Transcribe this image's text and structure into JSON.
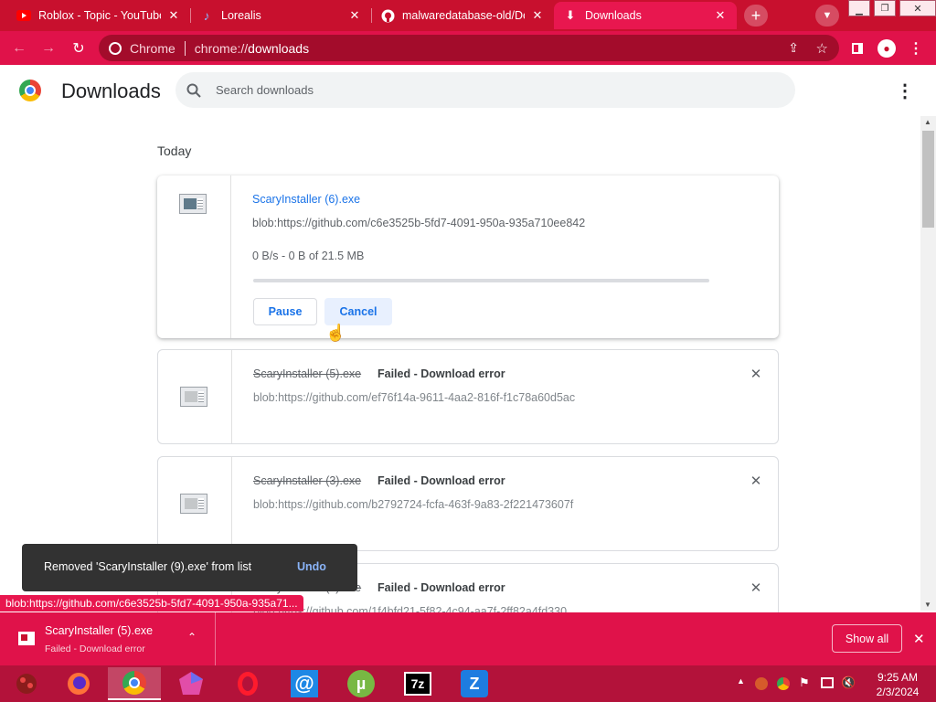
{
  "tabs": [
    {
      "title": "Roblox - Topic - YouTube",
      "icon": "youtube-icon"
    },
    {
      "title": "Lorealis",
      "icon": "music-note-icon"
    },
    {
      "title": "malwaredatabase-old/De",
      "icon": "github-icon"
    },
    {
      "title": "Downloads",
      "icon": "download-icon",
      "active": true
    }
  ],
  "omnibox": {
    "site_label": "Chrome",
    "url_prefix": "chrome://",
    "url_path": "downloads"
  },
  "header": {
    "title": "Downloads",
    "search_placeholder": "Search downloads"
  },
  "section_label": "Today",
  "downloads": [
    {
      "name": "ScaryInstaller (6).exe",
      "url": "blob:https://github.com/c6e3525b-5fd7-4091-950a-935a710ee842",
      "progress_text": "0 B/s - 0 B of 21.5 MB",
      "progress": 0.0,
      "buttons": [
        "Pause",
        "Cancel"
      ]
    },
    {
      "name": "ScaryInstaller (5).exe",
      "status": "Failed - Download error",
      "url": "blob:https://github.com/ef76f14a-9611-4aa2-816f-f1c78a60d5ac"
    },
    {
      "name": "ScaryInstaller (3).exe",
      "status": "Failed - Download error",
      "url": "blob:https://github.com/b2792724-fcfa-463f-9a83-2f221473607f"
    },
    {
      "name": "ScaryInstaller (2).exe",
      "status": "Failed - Download error",
      "url": "blob:https://github.com/1f4bfd21-5f82-4c94-aa7f-2ff82a4fd330"
    }
  ],
  "snackbar": {
    "message": "Removed 'ScaryInstaller (9).exe' from list",
    "action": "Undo"
  },
  "status_url": "blob:https://github.com/c6e3525b-5fd7-4091-950a-935a71...",
  "shelf": {
    "file_name": "ScaryInstaller (5).exe",
    "file_status": "Failed - Download error",
    "show_all": "Show all"
  },
  "taskbar": {
    "apps": [
      "roblox-app-icon",
      "firefox-icon",
      "chrome-icon",
      "crystal-app-icon",
      "opera-icon",
      "email-icon",
      "utorrent-icon",
      "7zip-icon",
      "zoom-app-icon"
    ],
    "time": "9:25 AM",
    "date": "2/3/2024"
  },
  "colors": {
    "accent": "#c8102e",
    "link": "#1a73e8"
  }
}
